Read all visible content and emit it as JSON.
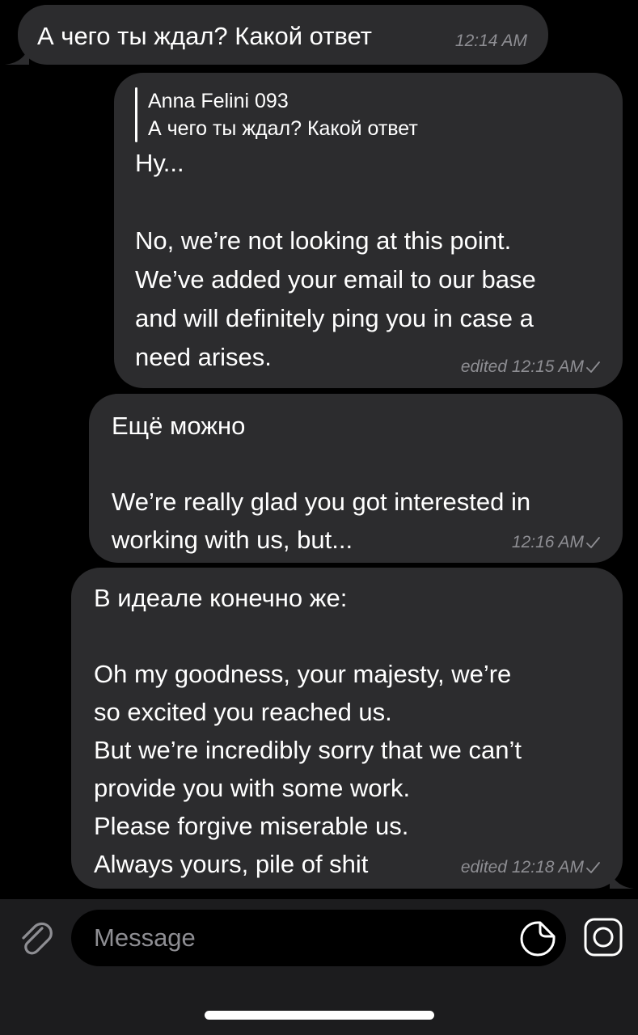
{
  "messages": [
    {
      "direction": "incoming",
      "text": "А чего ты ждал? Какой ответ",
      "time": "12:14 AM"
    },
    {
      "direction": "outgoing",
      "reply": {
        "author": "Anna Felini 093",
        "text": "А чего ты ждал? Какой ответ"
      },
      "text": "Ну...\n\nNo, we’re not looking at this point.\nWe’ve added your email to our base\nand will definitely ping you in case a\nneed arises.",
      "time": "edited 12:15 AM"
    },
    {
      "direction": "outgoing",
      "text": "Ещё можно\n\nWe’re really glad you got interested in\nworking with us, but...",
      "time": "12:16 AM"
    },
    {
      "direction": "outgoing",
      "text": "В идеале конечно же:\n\nOh my goodness, your majesty, we’re\nso excited you reached us.\nBut we’re incredibly sorry that we can’t\nprovide you with some work.\nPlease forgive miserable us.\nAlways yours, pile of shit",
      "time": "edited 12:18 AM"
    }
  ],
  "input": {
    "placeholder": "Message",
    "value": ""
  },
  "icons": {
    "attach": "paperclip-icon",
    "sticker": "sticker-icon",
    "camera": "camera-icon",
    "read_status": "checkmark-icon"
  },
  "colors": {
    "background": "#000000",
    "bubble": "#2c2c2e",
    "meta_text": "#8e8e93",
    "input_bar": "#1c1c1e"
  }
}
